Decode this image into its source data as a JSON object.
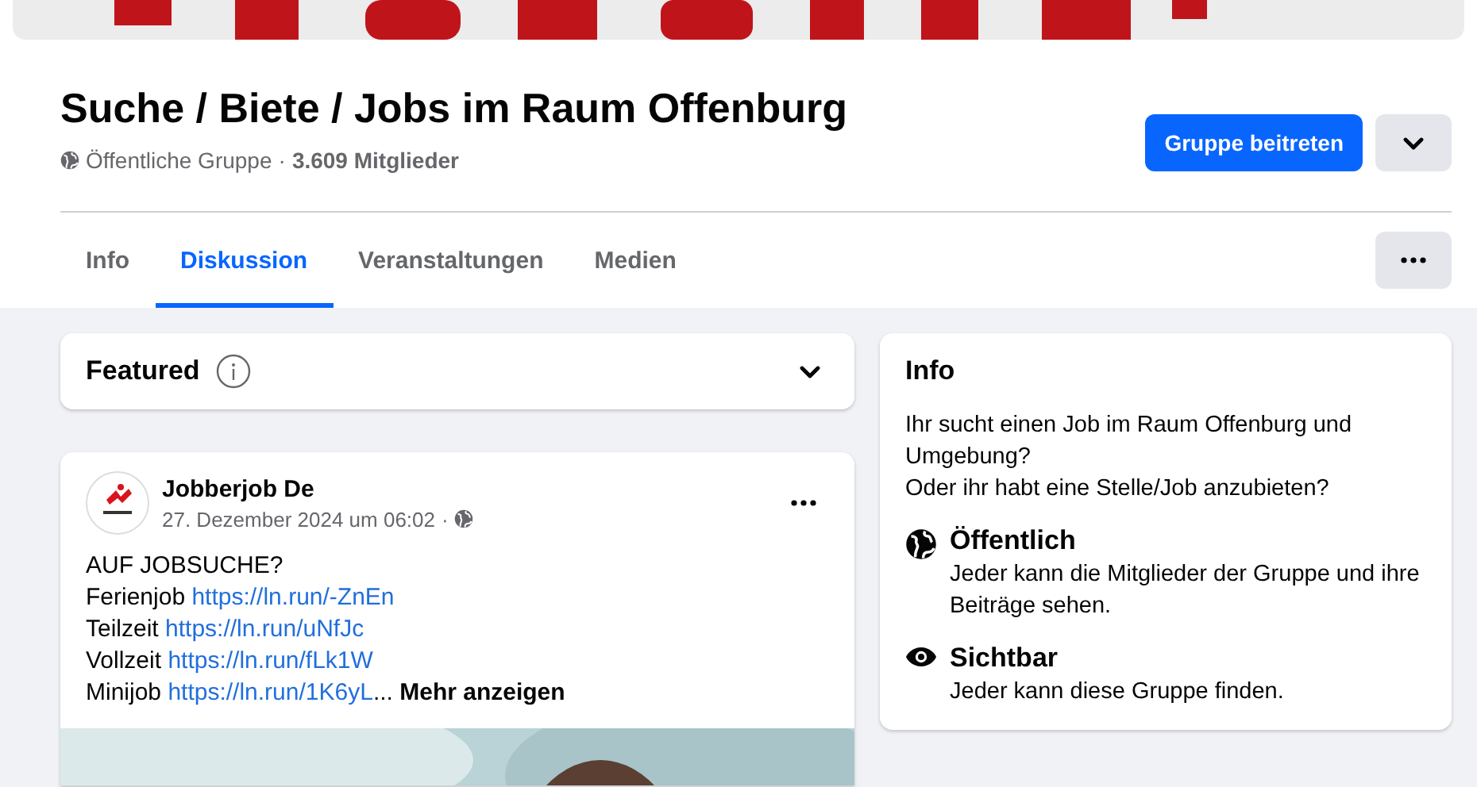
{
  "group": {
    "title": "Suche / Biete / Jobs im Raum Offenburg",
    "privacy": "Öffentliche Gruppe",
    "separator": "·",
    "members": "3.609 Mitglieder"
  },
  "join_button": "Gruppe beitreten",
  "tabs": [
    {
      "label": "Info",
      "selected": false
    },
    {
      "label": "Diskussion",
      "selected": true
    },
    {
      "label": "Veranstaltungen",
      "selected": false
    },
    {
      "label": "Medien",
      "selected": false
    }
  ],
  "featured": {
    "title": "Featured"
  },
  "post": {
    "author": "Jobberjob De",
    "date": "27. Dezember 2024 um 06:02",
    "separator": "·",
    "lines": [
      {
        "text": "AUF JOBSUCHE?"
      },
      {
        "text": "Ferienjob",
        "link": "https://ln.run/-ZnEn"
      },
      {
        "text": "Teilzeit",
        "link": "https://ln.run/uNfJc"
      },
      {
        "text": "Vollzeit",
        "link": "https://ln.run/fLk1W"
      },
      {
        "text": "Minijob",
        "link": "https://ln.run/1K6yL",
        "ellipsis": "..."
      }
    ],
    "more": "Mehr anzeigen"
  },
  "info": {
    "title": "Info",
    "description": [
      "Ihr sucht einen Job im Raum Offenburg und Umgebung?",
      "Oder ihr habt eine Stelle/Job anzubieten?"
    ],
    "items": [
      {
        "kind": "public",
        "title": "Öffentlich",
        "text": "Jeder kann die Mitglieder der Gruppe und ihre Beiträge sehen."
      },
      {
        "kind": "visible",
        "title": "Sichtbar",
        "text": "Jeder kann diese Gruppe finden."
      }
    ]
  }
}
